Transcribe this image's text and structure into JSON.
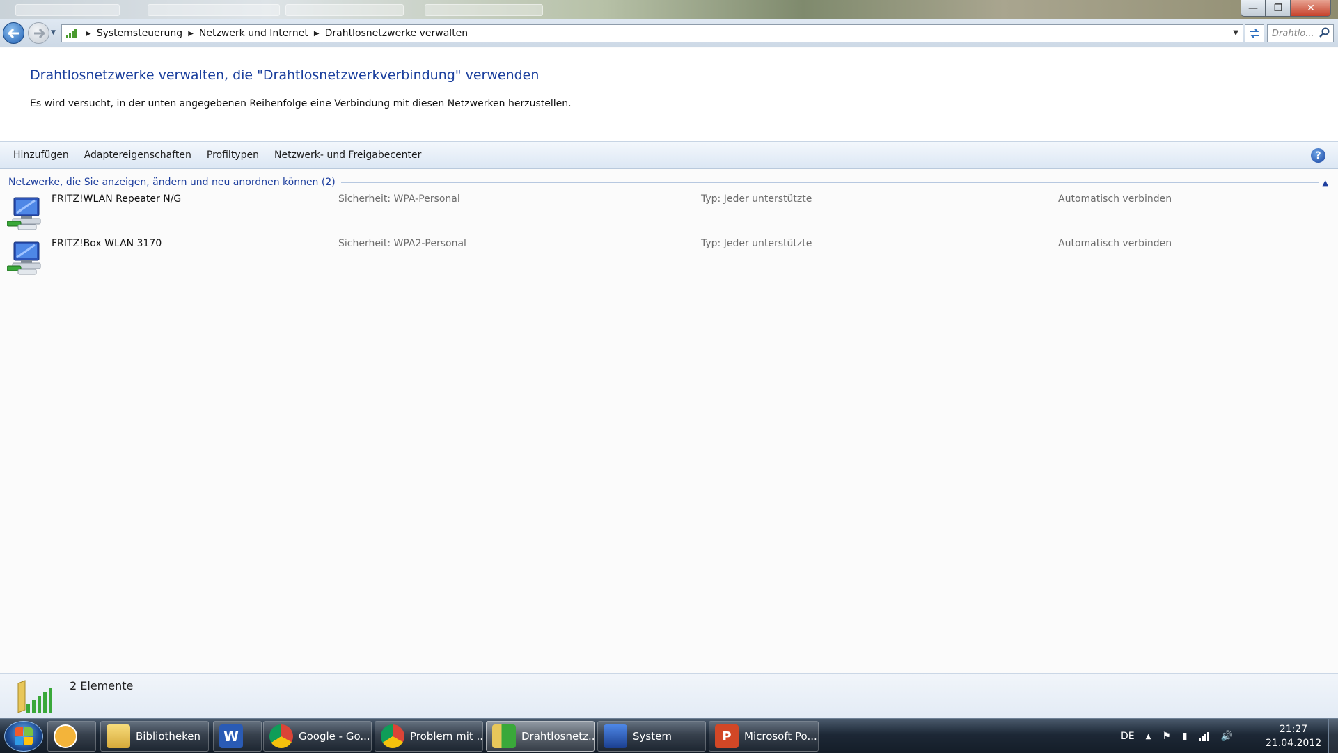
{
  "window": {
    "minimize_symbol": "—",
    "maximize_symbol": "❐",
    "close_symbol": "✕"
  },
  "navigation": {
    "breadcrumbs": [
      "Systemsteuerung",
      "Netzwerk und Internet",
      "Drahtlosnetzwerke verwalten"
    ],
    "search_placeholder": "Drahtlo..."
  },
  "header": {
    "title": "Drahtlosnetzwerke verwalten, die \"Drahtlosnetzwerkverbindung\" verwenden",
    "description": "Es wird versucht, in der unten angegebenen Reihenfolge eine Verbindung mit diesen Netzwerken herzustellen."
  },
  "toolbar": {
    "items": [
      "Hinzufügen",
      "Adaptereigenschaften",
      "Profiltypen",
      "Netzwerk- und Freigabecenter"
    ],
    "help_label": "?"
  },
  "group": {
    "title": "Netzwerke, die Sie anzeigen, ändern und neu anordnen können (2)"
  },
  "networks": [
    {
      "name": "FRITZ!WLAN Repeater N/G",
      "security": "Sicherheit:  WPA-Personal",
      "type": "Typ:  Jeder unterstützte",
      "mode": "Automatisch verbinden"
    },
    {
      "name": "FRITZ!Box WLAN 3170",
      "security": "Sicherheit:  WPA2-Personal",
      "type": "Typ:  Jeder unterstützte",
      "mode": "Automatisch verbinden"
    }
  ],
  "details": {
    "count_text": "2 Elemente"
  },
  "taskbar": {
    "items": [
      {
        "label": "",
        "icon": "outlook-icon"
      },
      {
        "label": "Bibliotheken",
        "icon": "folder-icon"
      },
      {
        "label": "",
        "icon": "word-icon"
      },
      {
        "label": "Google - Go...",
        "icon": "chrome-icon"
      },
      {
        "label": "Problem mit ...",
        "icon": "chrome-icon"
      },
      {
        "label": "Drahtlosnetz...",
        "icon": "wireless-folder-icon"
      },
      {
        "label": "System",
        "icon": "system-icon"
      },
      {
        "label": "Microsoft Po...",
        "icon": "powerpoint-icon"
      }
    ],
    "language": "DE",
    "time": "21:27",
    "date": "21.04.2012"
  },
  "colors": {
    "title_blue": "#1a3f9d",
    "group_blue": "#1e3f9e",
    "muted_text": "#6d6d6d"
  }
}
